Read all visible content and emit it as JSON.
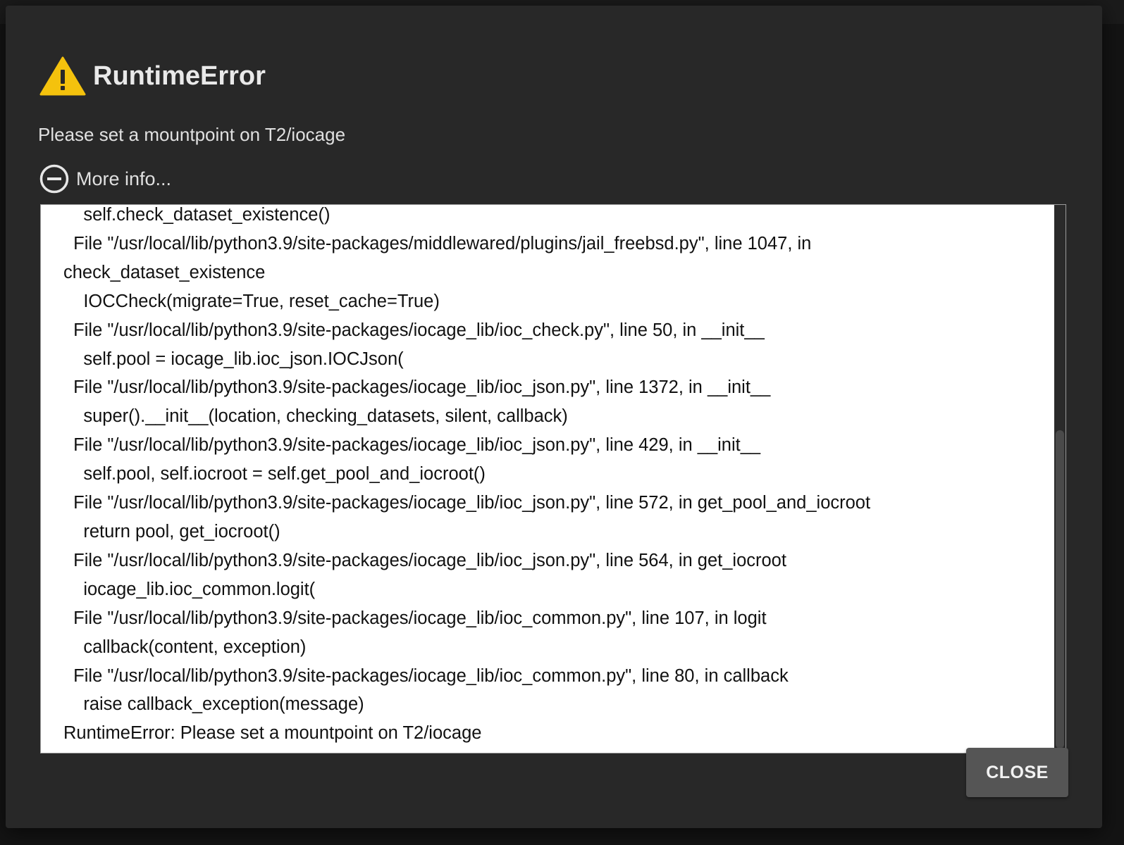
{
  "dialog": {
    "title": "RuntimeError",
    "message": "Please set a mountpoint on T2/iocage",
    "more_info_label": "More info...",
    "close_label": "CLOSE",
    "colors": {
      "warning_icon": "#f4c20d",
      "dialog_background": "#282828",
      "trace_background": "#ffffff",
      "close_button": "#555555"
    },
    "icons": {
      "title_icon": "warning-triangle-icon",
      "toggle_icon": "minus-circle-icon"
    }
  },
  "traceback": {
    "lines": [
      "    self.check_dataset_existence()",
      "  File \"/usr/local/lib/python3.9/site-packages/middlewared/plugins/jail_freebsd.py\", line 1047, in",
      "check_dataset_existence",
      "    IOCCheck(migrate=True, reset_cache=True)",
      "  File \"/usr/local/lib/python3.9/site-packages/iocage_lib/ioc_check.py\", line 50, in __init__",
      "    self.pool = iocage_lib.ioc_json.IOCJson(",
      "  File \"/usr/local/lib/python3.9/site-packages/iocage_lib/ioc_json.py\", line 1372, in __init__",
      "    super().__init__(location, checking_datasets, silent, callback)",
      "  File \"/usr/local/lib/python3.9/site-packages/iocage_lib/ioc_json.py\", line 429, in __init__",
      "    self.pool, self.iocroot = self.get_pool_and_iocroot()",
      "  File \"/usr/local/lib/python3.9/site-packages/iocage_lib/ioc_json.py\", line 572, in get_pool_and_iocroot",
      "    return pool, get_iocroot()",
      "  File \"/usr/local/lib/python3.9/site-packages/iocage_lib/ioc_json.py\", line 564, in get_iocroot",
      "    iocage_lib.ioc_common.logit(",
      "  File \"/usr/local/lib/python3.9/site-packages/iocage_lib/ioc_common.py\", line 107, in logit",
      "    callback(content, exception)",
      "  File \"/usr/local/lib/python3.9/site-packages/iocage_lib/ioc_common.py\", line 80, in callback",
      "    raise callback_exception(message)",
      "RuntimeError: Please set a mountpoint on T2/iocage"
    ]
  }
}
